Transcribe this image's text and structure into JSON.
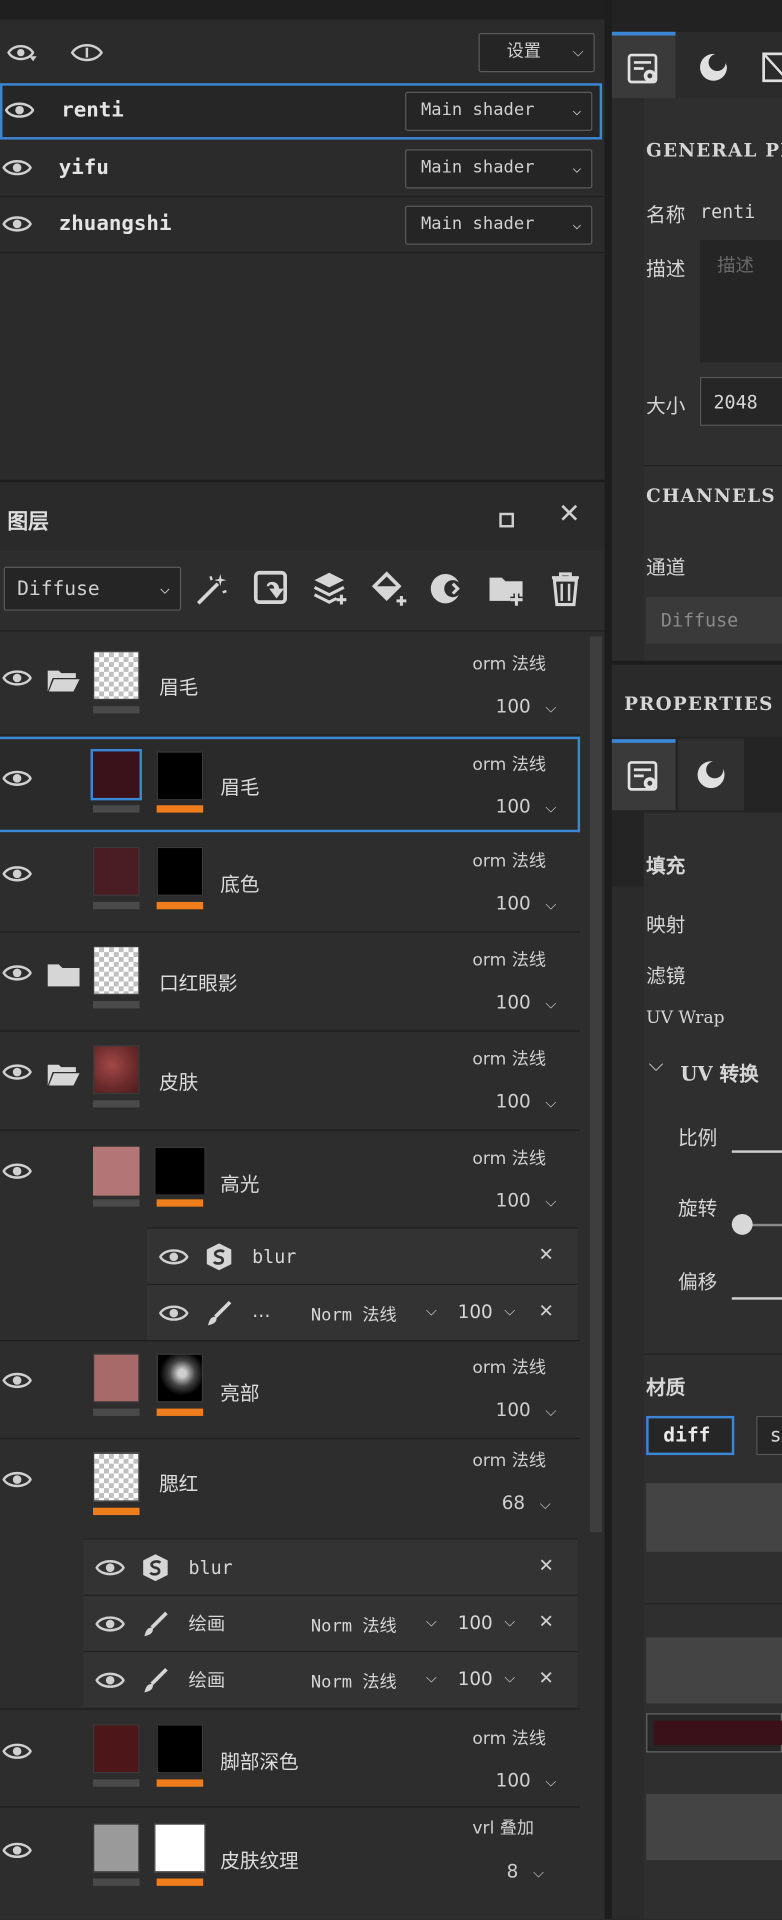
{
  "shader_panel": {
    "settings_label": "设置",
    "rows": [
      {
        "name": "renti",
        "shader": "Main shader",
        "selected": true
      },
      {
        "name": "yifu",
        "shader": "Main shader",
        "selected": false
      },
      {
        "name": "zhuangshi",
        "shader": "Main shader",
        "selected": false
      }
    ]
  },
  "layers_panel": {
    "title": "图层",
    "channel": "Diffuse",
    "layers": [
      {
        "name": "眉毛",
        "blend": "orm 法线",
        "opacity": "100"
      },
      {
        "name": "眉毛",
        "blend": "orm 法线",
        "opacity": "100"
      },
      {
        "name": "底色",
        "blend": "orm 法线",
        "opacity": "100"
      },
      {
        "name": "口红眼影",
        "blend": "orm 法线",
        "opacity": "100"
      },
      {
        "name": "皮肤",
        "blend": "orm 法线",
        "opacity": "100"
      },
      {
        "name": "高光",
        "blend": "orm 法线",
        "opacity": "100"
      },
      {
        "name": "亮部",
        "blend": "orm 法线",
        "opacity": "100"
      },
      {
        "name": "腮红",
        "blend": "orm 法线",
        "opacity": "68"
      },
      {
        "name": "脚部深色",
        "blend": "orm 法线",
        "opacity": "100"
      },
      {
        "name": "皮肤纹理",
        "blend": "vrl 叠加",
        "opacity": "8"
      }
    ],
    "effects_highlight": [
      {
        "name": "blur"
      },
      {
        "name": "…",
        "blend": "Norm 法线",
        "opacity": "100"
      }
    ],
    "effects_blush": [
      {
        "name": "blur"
      },
      {
        "name": "绘画",
        "blend": "Norm 法线",
        "opacity": "100"
      },
      {
        "name": "绘画",
        "blend": "Norm 法线",
        "opacity": "100"
      }
    ]
  },
  "texture_set": {
    "general_title": "GENERAL PR",
    "name_label": "名称",
    "name_value": "renti",
    "desc_label": "描述",
    "desc_placeholder": "描述",
    "size_label": "大小",
    "size_value": "2048",
    "channels_title": "CHANNELS",
    "channel_label": "通道",
    "channel_value": "Diffuse"
  },
  "properties": {
    "title": "PROPERTIES",
    "fill_label": "填充",
    "mapping_label": "映射",
    "filter_label": "滤镜",
    "uvwrap_label": "UV Wrap",
    "uv_transform_label": "UV 转换",
    "scale_label": "比例",
    "rotate_label": "旋转",
    "offset_label": "偏移",
    "material_label": "材质",
    "material_tab": "diff",
    "material_tab2": "s",
    "color_swatch": "#3a1118"
  }
}
